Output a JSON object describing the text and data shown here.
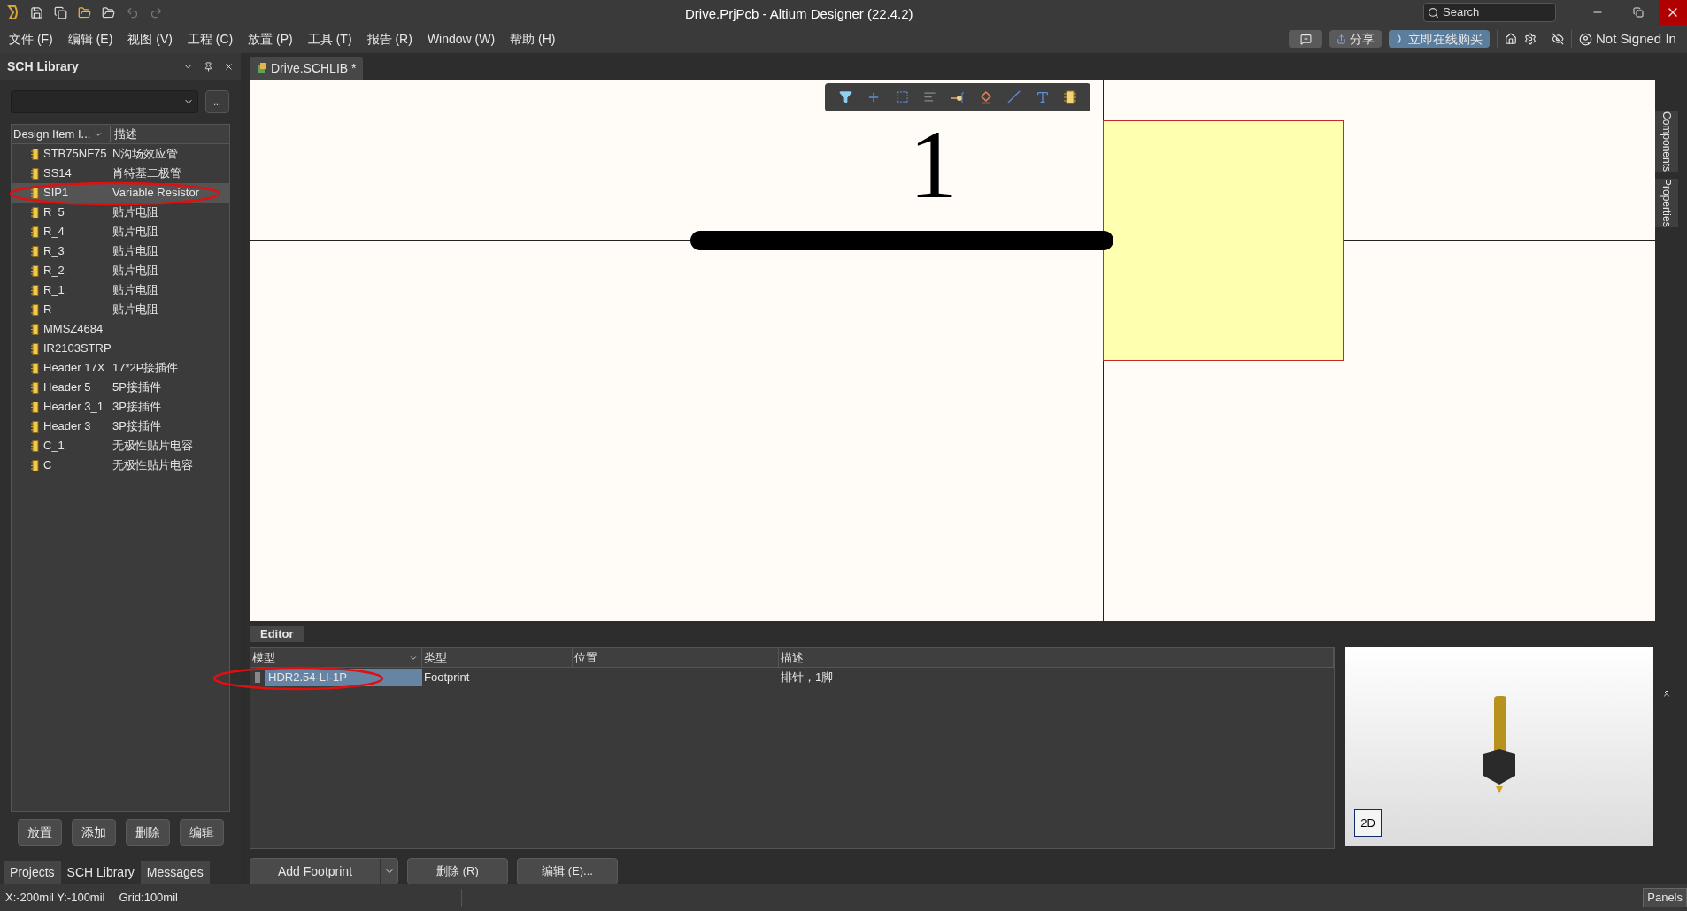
{
  "title_bar": {
    "title": "Drive.PrjPcb - Altium Designer (22.4.2)",
    "search_placeholder": "Search"
  },
  "menu": [
    "文件 (F)",
    "编辑 (E)",
    "视图 (V)",
    "工程 (C)",
    "放置 (P)",
    "工具 (T)",
    "报告 (R)",
    "Window (W)",
    "帮助 (H)"
  ],
  "header_actions": {
    "share": "分享",
    "buy": "立即在线购买",
    "user": "Not Signed In"
  },
  "left_panel": {
    "title": "SCH Library",
    "more_button": "...",
    "columns": [
      "Design Item I...",
      "描述"
    ],
    "items": [
      {
        "name": "STB75NF75",
        "description": "N沟场效应管",
        "selected": false
      },
      {
        "name": "SS14",
        "description": "肖特基二极管",
        "selected": false
      },
      {
        "name": "SIP1",
        "description": "Variable Resistor",
        "selected": true
      },
      {
        "name": "R_5",
        "description": "贴片电阻",
        "selected": false
      },
      {
        "name": "R_4",
        "description": "贴片电阻",
        "selected": false
      },
      {
        "name": "R_3",
        "description": "贴片电阻",
        "selected": false
      },
      {
        "name": "R_2",
        "description": "贴片电阻",
        "selected": false
      },
      {
        "name": "R_1",
        "description": "贴片电阻",
        "selected": false
      },
      {
        "name": "R",
        "description": "贴片电阻",
        "selected": false
      },
      {
        "name": "MMSZ4684",
        "selected": false
      },
      {
        "name": "IR2103STRP",
        "selected": false
      },
      {
        "name": "Header 17X",
        "description": "17*2P接插件",
        "selected": false
      },
      {
        "name": "Header 5",
        "description": "5P接插件",
        "selected": false
      },
      {
        "name": "Header 3_1",
        "description": "3P接插件",
        "selected": false
      },
      {
        "name": "Header 3",
        "description": "3P接插件",
        "selected": false
      },
      {
        "name": "C_1",
        "description": "无极性贴片电容",
        "selected": false
      },
      {
        "name": "C",
        "description": "无极性贴片电容",
        "selected": false
      }
    ],
    "buttons": [
      "放置",
      "添加",
      "删除",
      "编辑"
    ],
    "tabs": [
      {
        "label": "Projects",
        "selected": false
      },
      {
        "label": "SCH Library",
        "selected": true
      },
      {
        "label": "Messages",
        "selected": false
      }
    ]
  },
  "document_tab": {
    "label": "Drive.SCHLIB *"
  },
  "canvas": {
    "pin_designator": "1"
  },
  "right_tabs": [
    "Components",
    "Properties"
  ],
  "editor": {
    "tab": "Editor",
    "columns": [
      "模型",
      "类型",
      "位置",
      "描述"
    ],
    "rows": [
      {
        "model": "HDR2.54-LI-1P",
        "type": "Footprint",
        "location": "",
        "description": "排针，1脚",
        "selected": true
      }
    ],
    "buttons": [
      "Add Footprint",
      "删除 (R)",
      "编辑 (E)..."
    ],
    "preview": {
      "view_button": "2D"
    }
  },
  "status_bar": {
    "coordinates": "X:-200mil Y:-100mil",
    "grid": "Grid:100mil",
    "panels_button": "Panels"
  }
}
